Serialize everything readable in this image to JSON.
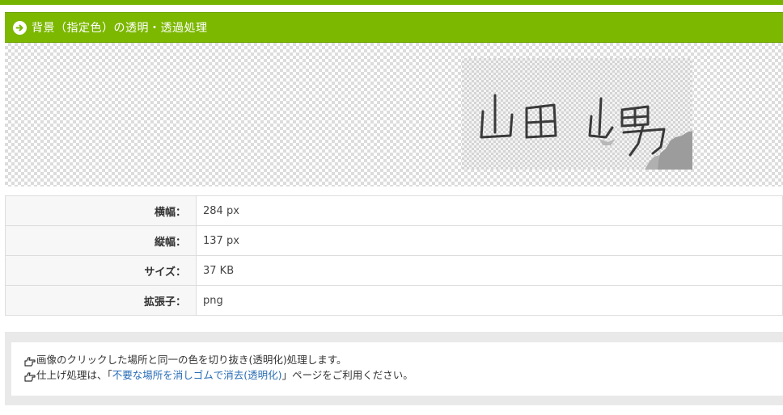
{
  "header": {
    "title": "背景（指定色）の透明・透過処理",
    "icon": "arrow-circle-right-icon",
    "color": "#7cb800"
  },
  "preview": {
    "signature_text": "山田 山男"
  },
  "info": {
    "rows": [
      {
        "label": "横幅：",
        "value": "284 px"
      },
      {
        "label": "縦幅：",
        "value": "137 px"
      },
      {
        "label": "サイズ：",
        "value": "37 KB"
      },
      {
        "label": "拡張子：",
        "value": "png"
      }
    ]
  },
  "notes": {
    "line1_text": "画像のクリックした場所と同一の色を切り抜き(透明化)処理します。",
    "line2_prefix": "仕上げ処理は、「",
    "line2_link": "不要な場所を消しゴムで消去(透明化)",
    "line2_suffix": "」ページをご利用ください。",
    "icon": "hand-point-right-icon"
  }
}
